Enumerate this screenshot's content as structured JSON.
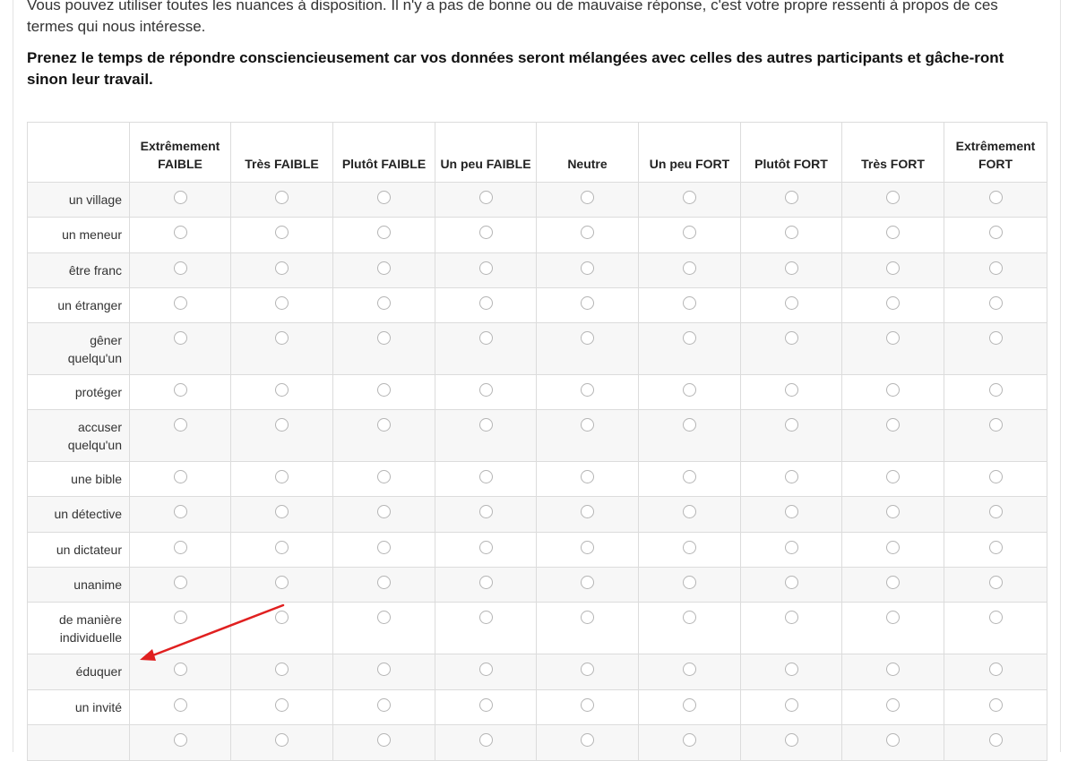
{
  "intro": {
    "line1": "Vous pouvez utiliser toutes les nuances à disposition. Il n'y a pas de bonne ou de mauvaise réponse, c'est votre propre ressenti à propos de ces termes qui nous intéresse.",
    "line2": "Prenez le temps de répondre consciencieusement car vos données seront mélangées avec celles des autres participants et gâche-ront sinon leur travail."
  },
  "scale": {
    "columns": [
      "Extrêmement FAIBLE",
      "Très FAIBLE",
      "Plutôt FAIBLE",
      "Un peu FAIBLE",
      "Neutre",
      "Un peu FORT",
      "Plutôt FORT",
      "Très FORT",
      "Extrêmement FORT"
    ],
    "rows": [
      "un village",
      "un meneur",
      "être franc",
      "un étranger",
      "gêner quelqu'un",
      "protéger",
      "accuser quelqu'un",
      "une bible",
      "un détective",
      "un dictateur",
      "unanime",
      "de manière individuelle",
      "éduquer",
      "un invité",
      ""
    ]
  },
  "annotation": {
    "arrow_color": "#e02020"
  }
}
